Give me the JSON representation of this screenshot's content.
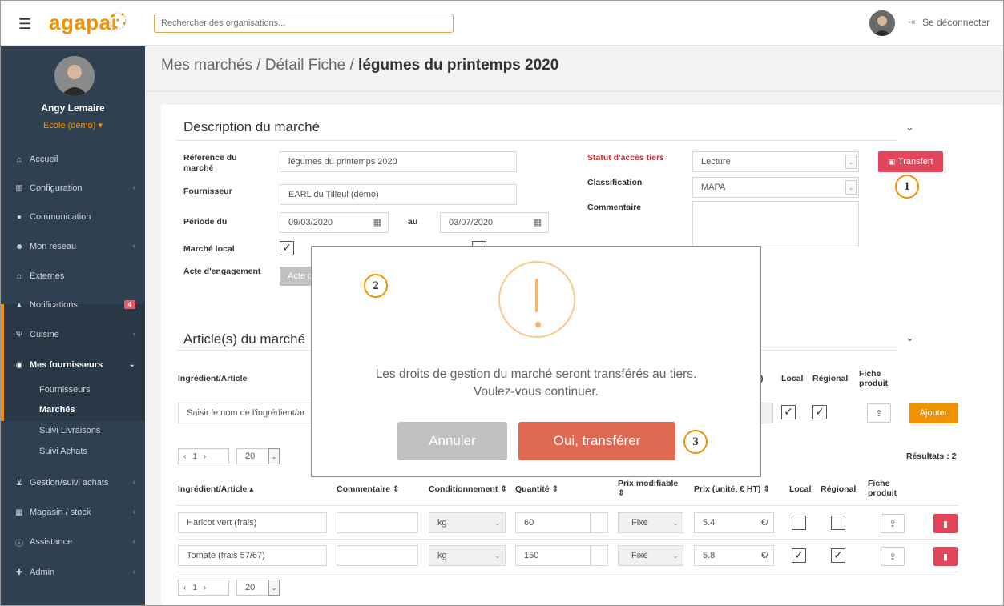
{
  "header": {
    "menu_icon": "hamburger-icon",
    "logo_text": "agapai",
    "search_placeholder": "Rechercher des organisations...",
    "logout_label": "Se déconnecter"
  },
  "sidebar": {
    "user_name": "Angy Lemaire",
    "user_role": "Ecole (démo) ▾",
    "items": [
      {
        "label": "Accueil",
        "icon": "home-icon"
      },
      {
        "label": "Configuration",
        "icon": "institution-icon"
      },
      {
        "label": "Communication",
        "icon": "comments-icon"
      },
      {
        "label": "Mon réseau",
        "icon": "users-icon"
      },
      {
        "label": "Externes",
        "icon": "home-icon"
      },
      {
        "label": "Notifications",
        "icon": "bell-icon",
        "badge": "4"
      },
      {
        "label": "Cuisine",
        "icon": "cutlery-icon"
      },
      {
        "label": "Mes fournisseurs",
        "icon": "eye-icon"
      },
      {
        "label": "Gestion/suivi achats",
        "icon": "cart-icon"
      },
      {
        "label": "Magasin / stock",
        "icon": "cubes-icon"
      },
      {
        "label": "Assistance",
        "icon": "info-icon"
      },
      {
        "label": "Admin",
        "icon": "user-plus-icon"
      }
    ],
    "subitems": [
      "Fournisseurs",
      "Marchés",
      "Suivi Livraisons",
      "Suivi Achats"
    ]
  },
  "breadcrumb": {
    "part1": "Mes marchés",
    "part2": "Détail Fiche",
    "current": "légumes du printemps 2020"
  },
  "description": {
    "title": "Description du marché",
    "ref_label": "Référence du marché",
    "ref_value": "légumes du printemps 2020",
    "supplier_label": "Fournisseur",
    "supplier_value": "EARL du Tilleul (démo)",
    "period_label": "Période du",
    "period_from": "09/03/2020",
    "period_to_label": "au",
    "period_to": "03/07/2020",
    "local_label": "Marché local",
    "act_label": "Acte d'engagement",
    "act_button": "Acte d",
    "access_label": "Statut d'accès tiers",
    "access_value": "Lecture",
    "class_label": "Classification",
    "class_value": "MAPA",
    "comment_label": "Commentaire",
    "transfer_button": "Transfert"
  },
  "articles": {
    "title": "Article(s) du marché",
    "add_header": {
      "ingredient": "Ingrédient/Article",
      "prix_partial": ")",
      "local": "Local",
      "regional": "Régional",
      "fiche": "Fiche produit"
    },
    "ingredient_placeholder": "Saisir le nom de l'ingrédient/ar",
    "add_button": "Ajouter",
    "pager_page": "1",
    "pager_size": "20",
    "results": "Résultats : 2",
    "columns": {
      "ingredient": "Ingrédient/Article ▴",
      "comment": "Commentaire ⇕",
      "packaging": "Conditionnement ⇕",
      "quantity": "Quantité ⇕",
      "price_mod": "Prix modifiable ⇕",
      "price": "Prix (unité, € HT) ⇕",
      "local": "Local",
      "regional": "Régional",
      "fiche": "Fiche produit"
    },
    "rows": [
      {
        "name": "Haricot vert (frais)",
        "unit": "kg",
        "qty": "60",
        "mod": "Fixe",
        "price": "5.4",
        "currency": "€/",
        "local": false,
        "regional": false
      },
      {
        "name": "Tomate (frais  57/67)",
        "unit": "kg",
        "qty": "150",
        "mod": "Fixe",
        "price": "5.8",
        "currency": "€/",
        "local": true,
        "regional": true
      }
    ]
  },
  "modal": {
    "line1": "Les droits de gestion du marché seront transférés au tiers.",
    "line2": "Voulez-vous continuer.",
    "cancel": "Annuler",
    "confirm": "Oui, transférer"
  },
  "callouts": [
    "1",
    "2",
    "3"
  ],
  "colors": {
    "brand": "#f39200",
    "sidebar": "#2f4050",
    "danger": "#df6953",
    "transfer": "#e3465a"
  }
}
